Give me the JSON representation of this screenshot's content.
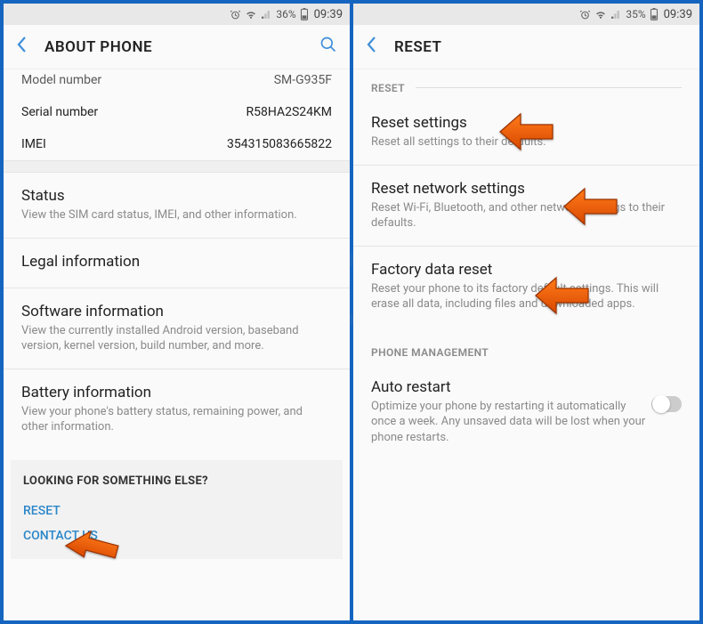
{
  "left": {
    "status": {
      "battery": "36%",
      "time": "09:39"
    },
    "header": {
      "title": "ABOUT PHONE"
    },
    "info": {
      "rows": [
        {
          "label": "Model number",
          "value": "SM-G935F"
        },
        {
          "label": "Serial number",
          "value": "R58HA2S24KM"
        },
        {
          "label": "IMEI",
          "value": "354315083665822"
        }
      ]
    },
    "items": [
      {
        "title": "Status",
        "sub": "View the SIM card status, IMEI, and other information."
      },
      {
        "title": "Legal information",
        "sub": ""
      },
      {
        "title": "Software information",
        "sub": "View the currently installed Android version, baseband version, kernel version, build number, and more."
      },
      {
        "title": "Battery information",
        "sub": "View your phone's battery status, remaining power, and other information."
      }
    ],
    "footer": {
      "header": "LOOKING FOR SOMETHING ELSE?",
      "links": [
        "RESET",
        "CONTACT US"
      ]
    }
  },
  "right": {
    "status": {
      "battery": "35%",
      "time": "09:39"
    },
    "header": {
      "title": "RESET"
    },
    "sections": {
      "reset_header": "RESET",
      "reset_items": [
        {
          "title": "Reset settings",
          "sub": "Reset all settings to their defaults."
        },
        {
          "title": "Reset network settings",
          "sub": "Reset Wi-Fi, Bluetooth, and other network settings to their defaults."
        },
        {
          "title": "Factory data reset",
          "sub": "Reset your phone to its factory default settings. This will erase all data, including files and downloaded apps."
        }
      ],
      "pm_header": "PHONE MANAGEMENT",
      "auto_restart": {
        "title": "Auto restart",
        "sub": "Optimize your phone by restarting it automatically once a week. Any unsaved data will be lost when your phone restarts."
      }
    }
  }
}
